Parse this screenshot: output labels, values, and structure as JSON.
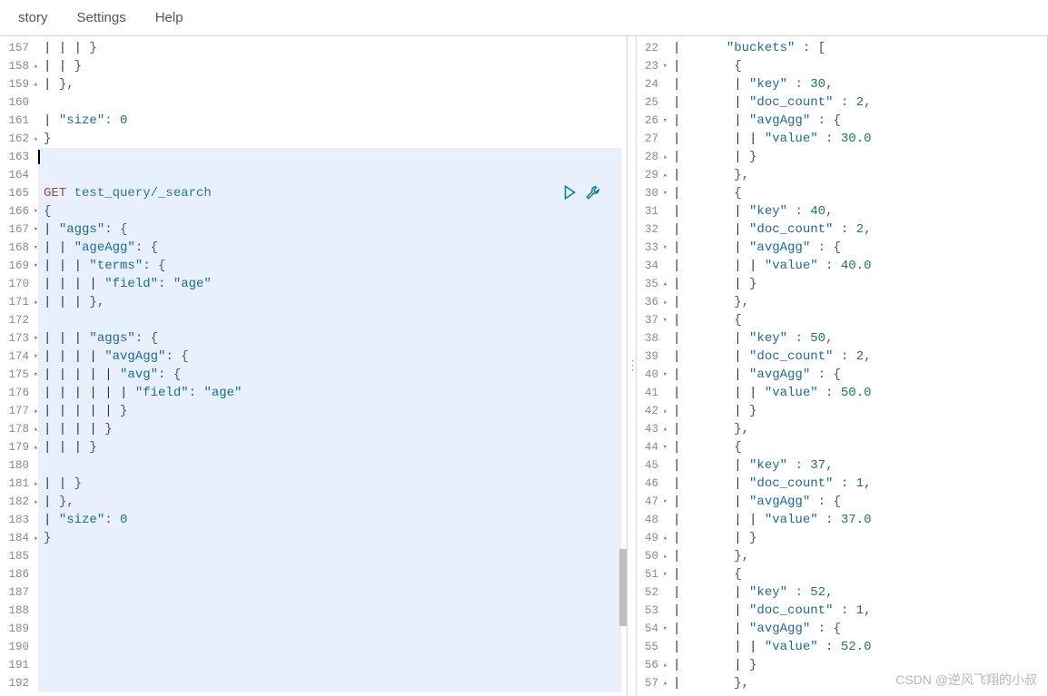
{
  "menu": {
    "history": "story",
    "settings": "Settings",
    "help": "Help"
  },
  "watermark": "CSDN @逆风飞翔的小叔",
  "leftEditor": {
    "startLine": 157,
    "cursorLine": 163,
    "activeRequestLine": 165,
    "lines": [
      {
        "n": 157,
        "fold": "",
        "tokens": [
          [
            "guide",
            "| | | "
          ],
          [
            "brace",
            "}"
          ]
        ]
      },
      {
        "n": 158,
        "fold": "▴",
        "tokens": [
          [
            "guide",
            "| | "
          ],
          [
            "brace",
            "}"
          ]
        ]
      },
      {
        "n": 159,
        "fold": "▴",
        "tokens": [
          [
            "guide",
            "| "
          ],
          [
            "brace",
            "},"
          ]
        ]
      },
      {
        "n": 160,
        "fold": "",
        "tokens": []
      },
      {
        "n": 161,
        "fold": "",
        "tokens": [
          [
            "guide",
            "| "
          ],
          [
            "key",
            "\"size\""
          ],
          [
            "punct",
            ": "
          ],
          [
            "num",
            "0"
          ]
        ]
      },
      {
        "n": 162,
        "fold": "▴",
        "tokens": [
          [
            "brace",
            "}"
          ]
        ]
      },
      {
        "n": 163,
        "fold": "",
        "cursor": true,
        "tokens": []
      },
      {
        "n": 164,
        "fold": "",
        "tokens": []
      },
      {
        "n": 165,
        "fold": "",
        "tokens": [
          [
            "method",
            "GET "
          ],
          [
            "url",
            "test_query/_search"
          ]
        ]
      },
      {
        "n": 166,
        "fold": "▾",
        "tokens": [
          [
            "brace",
            "{"
          ]
        ]
      },
      {
        "n": 167,
        "fold": "▾",
        "tokens": [
          [
            "guide",
            "| "
          ],
          [
            "key",
            "\"aggs\""
          ],
          [
            "punct",
            ": "
          ],
          [
            "brace",
            "{"
          ]
        ]
      },
      {
        "n": 168,
        "fold": "▾",
        "tokens": [
          [
            "guide",
            "| | "
          ],
          [
            "key",
            "\"ageAgg\""
          ],
          [
            "punct",
            ": "
          ],
          [
            "brace",
            "{"
          ]
        ]
      },
      {
        "n": 169,
        "fold": "▾",
        "tokens": [
          [
            "guide",
            "| | | "
          ],
          [
            "key",
            "\"terms\""
          ],
          [
            "punct",
            ": "
          ],
          [
            "brace",
            "{"
          ]
        ]
      },
      {
        "n": 170,
        "fold": "",
        "tokens": [
          [
            "guide",
            "| | | | "
          ],
          [
            "key",
            "\"field\""
          ],
          [
            "punct",
            ": "
          ],
          [
            "str",
            "\"age\""
          ]
        ]
      },
      {
        "n": 171,
        "fold": "▴",
        "tokens": [
          [
            "guide",
            "| | | "
          ],
          [
            "brace",
            "},"
          ]
        ]
      },
      {
        "n": 172,
        "fold": "",
        "tokens": []
      },
      {
        "n": 173,
        "fold": "▾",
        "tokens": [
          [
            "guide",
            "| | | "
          ],
          [
            "key",
            "\"aggs\""
          ],
          [
            "punct",
            ": "
          ],
          [
            "brace",
            "{"
          ]
        ]
      },
      {
        "n": 174,
        "fold": "▾",
        "tokens": [
          [
            "guide",
            "| | | | "
          ],
          [
            "key",
            "\"avgAgg\""
          ],
          [
            "punct",
            ": "
          ],
          [
            "brace",
            "{"
          ]
        ]
      },
      {
        "n": 175,
        "fold": "▾",
        "tokens": [
          [
            "guide",
            "| | | | | "
          ],
          [
            "key",
            "\"avg\""
          ],
          [
            "punct",
            ": "
          ],
          [
            "brace",
            "{"
          ]
        ]
      },
      {
        "n": 176,
        "fold": "",
        "tokens": [
          [
            "guide",
            "| | | | | | "
          ],
          [
            "key",
            "\"field\""
          ],
          [
            "punct",
            ": "
          ],
          [
            "str",
            "\"age\""
          ]
        ]
      },
      {
        "n": 177,
        "fold": "▴",
        "tokens": [
          [
            "guide",
            "| | | | | "
          ],
          [
            "brace",
            "}"
          ]
        ]
      },
      {
        "n": 178,
        "fold": "▴",
        "tokens": [
          [
            "guide",
            "| | | | "
          ],
          [
            "brace",
            "}"
          ]
        ]
      },
      {
        "n": 179,
        "fold": "▴",
        "tokens": [
          [
            "guide",
            "| | | "
          ],
          [
            "brace",
            "}"
          ]
        ]
      },
      {
        "n": 180,
        "fold": "",
        "tokens": []
      },
      {
        "n": 181,
        "fold": "▴",
        "tokens": [
          [
            "guide",
            "| | "
          ],
          [
            "brace",
            "}"
          ]
        ]
      },
      {
        "n": 182,
        "fold": "▴",
        "tokens": [
          [
            "guide",
            "| "
          ],
          [
            "brace",
            "},"
          ]
        ]
      },
      {
        "n": 183,
        "fold": "",
        "tokens": [
          [
            "guide",
            "| "
          ],
          [
            "key",
            "\"size\""
          ],
          [
            "punct",
            ": "
          ],
          [
            "num",
            "0"
          ]
        ]
      },
      {
        "n": 184,
        "fold": "▴",
        "tokens": [
          [
            "brace",
            "}"
          ]
        ]
      },
      {
        "n": 185,
        "fold": "",
        "tokens": []
      },
      {
        "n": 186,
        "fold": "",
        "tokens": []
      },
      {
        "n": 187,
        "fold": "",
        "tokens": []
      },
      {
        "n": 188,
        "fold": "",
        "tokens": []
      },
      {
        "n": 189,
        "fold": "",
        "tokens": []
      },
      {
        "n": 190,
        "fold": "",
        "tokens": []
      },
      {
        "n": 191,
        "fold": "",
        "tokens": []
      },
      {
        "n": 192,
        "fold": "",
        "tokens": []
      }
    ]
  },
  "rightEditor": {
    "startLine": 22,
    "lines": [
      {
        "n": 22,
        "fold": "",
        "tokens": [
          [
            "guide",
            "|     "
          ],
          [
            "key",
            " \"buckets\""
          ],
          [
            "punct",
            " : "
          ],
          [
            "brace",
            "["
          ]
        ]
      },
      {
        "n": 23,
        "fold": "▾",
        "tokens": [
          [
            "guide",
            "|       "
          ],
          [
            "brace",
            "{"
          ]
        ]
      },
      {
        "n": 24,
        "fold": "",
        "tokens": [
          [
            "guide",
            "|       | "
          ],
          [
            "key",
            "\"key\" "
          ],
          [
            "punct",
            ": "
          ],
          [
            "num",
            "30"
          ],
          [
            "punct",
            ","
          ]
        ]
      },
      {
        "n": 25,
        "fold": "",
        "tokens": [
          [
            "guide",
            "|       | "
          ],
          [
            "key",
            "\"doc_count\" "
          ],
          [
            "punct",
            ": "
          ],
          [
            "num",
            "2"
          ],
          [
            "punct",
            ","
          ]
        ]
      },
      {
        "n": 26,
        "fold": "▾",
        "tokens": [
          [
            "guide",
            "|       | "
          ],
          [
            "key",
            "\"avgAgg\" "
          ],
          [
            "punct",
            ": "
          ],
          [
            "brace",
            "{"
          ]
        ]
      },
      {
        "n": 27,
        "fold": "",
        "tokens": [
          [
            "guide",
            "|       | | "
          ],
          [
            "key",
            "\"value\" "
          ],
          [
            "punct",
            ": "
          ],
          [
            "num",
            "30.0"
          ]
        ]
      },
      {
        "n": 28,
        "fold": "▴",
        "tokens": [
          [
            "guide",
            "|       | "
          ],
          [
            "brace",
            "}"
          ]
        ]
      },
      {
        "n": 29,
        "fold": "▴",
        "tokens": [
          [
            "guide",
            "|       "
          ],
          [
            "brace",
            "},"
          ]
        ]
      },
      {
        "n": 30,
        "fold": "▾",
        "tokens": [
          [
            "guide",
            "|       "
          ],
          [
            "brace",
            "{"
          ]
        ]
      },
      {
        "n": 31,
        "fold": "",
        "tokens": [
          [
            "guide",
            "|       | "
          ],
          [
            "key",
            "\"key\" "
          ],
          [
            "punct",
            ": "
          ],
          [
            "num",
            "40"
          ],
          [
            "punct",
            ","
          ]
        ]
      },
      {
        "n": 32,
        "fold": "",
        "tokens": [
          [
            "guide",
            "|       | "
          ],
          [
            "key",
            "\"doc_count\" "
          ],
          [
            "punct",
            ": "
          ],
          [
            "num",
            "2"
          ],
          [
            "punct",
            ","
          ]
        ]
      },
      {
        "n": 33,
        "fold": "▾",
        "tokens": [
          [
            "guide",
            "|       | "
          ],
          [
            "key",
            "\"avgAgg\" "
          ],
          [
            "punct",
            ": "
          ],
          [
            "brace",
            "{"
          ]
        ]
      },
      {
        "n": 34,
        "fold": "",
        "tokens": [
          [
            "guide",
            "|       | | "
          ],
          [
            "key",
            "\"value\" "
          ],
          [
            "punct",
            ": "
          ],
          [
            "num",
            "40.0"
          ]
        ]
      },
      {
        "n": 35,
        "fold": "▴",
        "tokens": [
          [
            "guide",
            "|       | "
          ],
          [
            "brace",
            "}"
          ]
        ]
      },
      {
        "n": 36,
        "fold": "▴",
        "tokens": [
          [
            "guide",
            "|       "
          ],
          [
            "brace",
            "},"
          ]
        ]
      },
      {
        "n": 37,
        "fold": "▾",
        "tokens": [
          [
            "guide",
            "|       "
          ],
          [
            "brace",
            "{"
          ]
        ]
      },
      {
        "n": 38,
        "fold": "",
        "tokens": [
          [
            "guide",
            "|       | "
          ],
          [
            "key",
            "\"key\" "
          ],
          [
            "punct",
            ": "
          ],
          [
            "num",
            "50"
          ],
          [
            "punct",
            ","
          ]
        ]
      },
      {
        "n": 39,
        "fold": "",
        "tokens": [
          [
            "guide",
            "|       | "
          ],
          [
            "key",
            "\"doc_count\" "
          ],
          [
            "punct",
            ": "
          ],
          [
            "num",
            "2"
          ],
          [
            "punct",
            ","
          ]
        ]
      },
      {
        "n": 40,
        "fold": "▾",
        "tokens": [
          [
            "guide",
            "|       | "
          ],
          [
            "key",
            "\"avgAgg\" "
          ],
          [
            "punct",
            ": "
          ],
          [
            "brace",
            "{"
          ]
        ]
      },
      {
        "n": 41,
        "fold": "",
        "tokens": [
          [
            "guide",
            "|       | | "
          ],
          [
            "key",
            "\"value\" "
          ],
          [
            "punct",
            ": "
          ],
          [
            "num",
            "50.0"
          ]
        ]
      },
      {
        "n": 42,
        "fold": "▴",
        "tokens": [
          [
            "guide",
            "|       | "
          ],
          [
            "brace",
            "}"
          ]
        ]
      },
      {
        "n": 43,
        "fold": "▴",
        "tokens": [
          [
            "guide",
            "|       "
          ],
          [
            "brace",
            "},"
          ]
        ]
      },
      {
        "n": 44,
        "fold": "▾",
        "tokens": [
          [
            "guide",
            "|       "
          ],
          [
            "brace",
            "{"
          ]
        ]
      },
      {
        "n": 45,
        "fold": "",
        "tokens": [
          [
            "guide",
            "|       | "
          ],
          [
            "key",
            "\"key\" "
          ],
          [
            "punct",
            ": "
          ],
          [
            "num",
            "37"
          ],
          [
            "punct",
            ","
          ]
        ]
      },
      {
        "n": 46,
        "fold": "",
        "tokens": [
          [
            "guide",
            "|       | "
          ],
          [
            "key",
            "\"doc_count\" "
          ],
          [
            "punct",
            ": "
          ],
          [
            "num",
            "1"
          ],
          [
            "punct",
            ","
          ]
        ]
      },
      {
        "n": 47,
        "fold": "▾",
        "tokens": [
          [
            "guide",
            "|       | "
          ],
          [
            "key",
            "\"avgAgg\" "
          ],
          [
            "punct",
            ": "
          ],
          [
            "brace",
            "{"
          ]
        ]
      },
      {
        "n": 48,
        "fold": "",
        "tokens": [
          [
            "guide",
            "|       | | "
          ],
          [
            "key",
            "\"value\" "
          ],
          [
            "punct",
            ": "
          ],
          [
            "num",
            "37.0"
          ]
        ]
      },
      {
        "n": 49,
        "fold": "▴",
        "tokens": [
          [
            "guide",
            "|       | "
          ],
          [
            "brace",
            "}"
          ]
        ]
      },
      {
        "n": 50,
        "fold": "▴",
        "tokens": [
          [
            "guide",
            "|       "
          ],
          [
            "brace",
            "},"
          ]
        ]
      },
      {
        "n": 51,
        "fold": "▾",
        "tokens": [
          [
            "guide",
            "|       "
          ],
          [
            "brace",
            "{"
          ]
        ]
      },
      {
        "n": 52,
        "fold": "",
        "tokens": [
          [
            "guide",
            "|       | "
          ],
          [
            "key",
            "\"key\" "
          ],
          [
            "punct",
            ": "
          ],
          [
            "num",
            "52"
          ],
          [
            "punct",
            ","
          ]
        ]
      },
      {
        "n": 53,
        "fold": "",
        "tokens": [
          [
            "guide",
            "|       | "
          ],
          [
            "key",
            "\"doc_count\" "
          ],
          [
            "punct",
            ": "
          ],
          [
            "num",
            "1"
          ],
          [
            "punct",
            ","
          ]
        ]
      },
      {
        "n": 54,
        "fold": "▾",
        "tokens": [
          [
            "guide",
            "|       | "
          ],
          [
            "key",
            "\"avgAgg\" "
          ],
          [
            "punct",
            ": "
          ],
          [
            "brace",
            "{"
          ]
        ]
      },
      {
        "n": 55,
        "fold": "",
        "tokens": [
          [
            "guide",
            "|       | | "
          ],
          [
            "key",
            "\"value\" "
          ],
          [
            "punct",
            ": "
          ],
          [
            "num",
            "52.0"
          ]
        ]
      },
      {
        "n": 56,
        "fold": "▴",
        "tokens": [
          [
            "guide",
            "|       | "
          ],
          [
            "brace",
            "}"
          ]
        ]
      },
      {
        "n": 57,
        "fold": "▴",
        "tokens": [
          [
            "guide",
            "|       "
          ],
          [
            "brace",
            "},"
          ]
        ]
      }
    ]
  }
}
